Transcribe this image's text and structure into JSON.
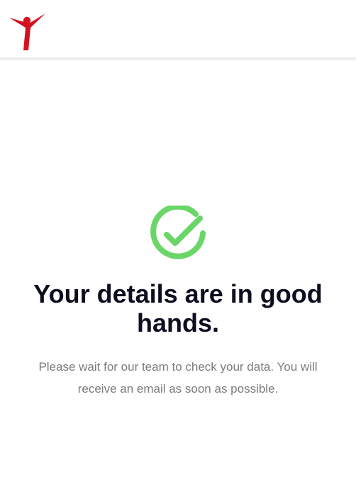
{
  "header": {
    "logo_icon": "person-raising-arms-icon",
    "logo_color": "#d4121f"
  },
  "main": {
    "status_icon": "check-circle-icon",
    "status_color": "#6ad668",
    "headline": "Your details are in good hands.",
    "message": "Please wait for our team to check your data. You will receive an email as soon as possible."
  }
}
